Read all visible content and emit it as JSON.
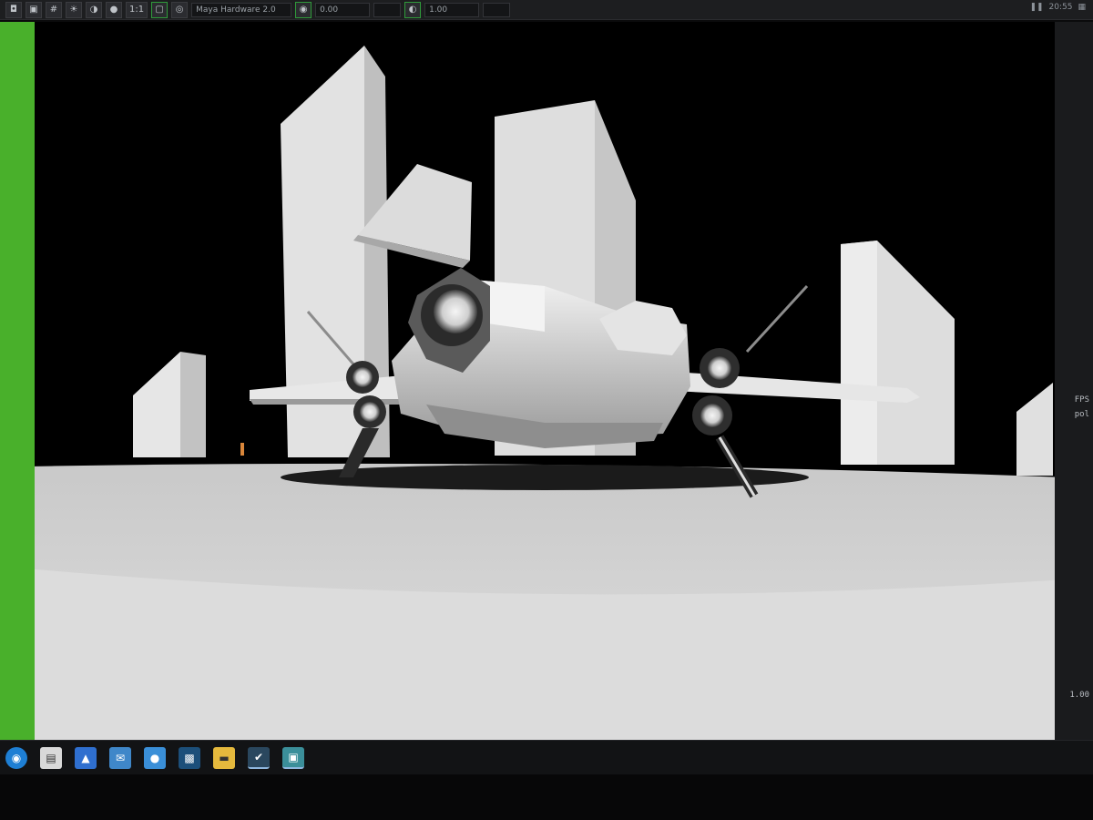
{
  "toolbar": {
    "renderer": "Maya Hardware 2.0",
    "exposure": "0.00",
    "gamma": "1.00",
    "ratio": "1:1",
    "clock": "20:55"
  },
  "side_panel": {
    "labels": [
      "FPS",
      "pol",
      "1.00"
    ]
  },
  "taskbar": {
    "icons": [
      {
        "name": "windows-start-icon",
        "color": "#1e7fd4"
      },
      {
        "name": "store-icon",
        "color": "#d9d9d9"
      },
      {
        "name": "photos-icon",
        "color": "#2f6fcf"
      },
      {
        "name": "mail-icon",
        "color": "#3f87c9"
      },
      {
        "name": "droplet-icon",
        "color": "#3a8fd8"
      },
      {
        "name": "photoshop-icon",
        "color": "#1c4f7a"
      },
      {
        "name": "folder-icon",
        "color": "#e5b93d"
      },
      {
        "name": "steam-icon",
        "color": "#2a475e"
      },
      {
        "name": "maya-icon",
        "color": "#3b8f9a"
      }
    ]
  },
  "colors": {
    "viewport_border": "#49b02b",
    "background": "#000000"
  }
}
